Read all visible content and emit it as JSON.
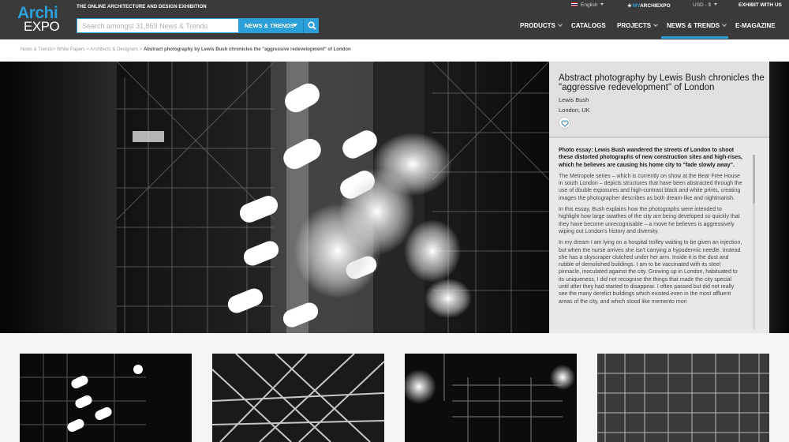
{
  "header": {
    "logo_top": "Archi",
    "logo_bottom": "EXPO",
    "tagline": "THE ONLINE ARCHITECTURE AND DESIGN EXHIBITION",
    "search_placeholder": "Search amongst 31,869 News & Trends",
    "search_category": "NEWS & TRENDS",
    "language": "English",
    "my_account_prefix": "MY",
    "my_account_suffix": "ARCHIEXPO",
    "currency": "USD - $",
    "exhibit": "EXHIBIT WITH US",
    "accent_color": "#2a9fd8",
    "nav": [
      {
        "label": "PRODUCTS",
        "has_menu": true
      },
      {
        "label": "CATALOGS",
        "has_menu": false
      },
      {
        "label": "PROJECTS",
        "has_menu": true
      },
      {
        "label": "NEWS & TRENDS",
        "has_menu": true,
        "active": true
      },
      {
        "label": "E-MAGAZINE",
        "has_menu": false
      }
    ]
  },
  "breadcrumb": {
    "items": [
      "News & Trends",
      "White Papers",
      "Architects & Designers"
    ],
    "current": "Abstract photography by Lewis Bush chronicles the \"aggressive redevelopment\" of London"
  },
  "article": {
    "title": "Abstract photography by Lewis Bush chronicles the \"aggressive redevelopment\" of London",
    "author": "Lewis Bush",
    "location": "London, UK",
    "paragraphs": [
      "Photo essay: Lewis Bush wandered the streets of London to shoot these distorted photographs of new construction sites and high-rises, which he believes are causing his home city to \"fade slowly away\".",
      "The Metropole series – which is currently on show at the Bear Free House in south London – depicts structures that have been abstracted through the use of double exposures and high-contrast black and white prints, creating images the photographer describes as both dream-like and nightmarish.",
      "In this essay, Bush explains how the photographs were intended to highlight how large swathes of the city are being developed so quickly that they have become unrecognisable – a move he believes is aggressively wiping out London's history and diversity.",
      "In my dream I am lying on a hospital trolley waiting to be given an injection, but when the nurse arrives she isn't carrying a hypodermic needle. Instead she has a skyscraper clutched under her arm. Inside it is the dust and rubble of demolished buildings. I am to be vaccinated with its steel pinnacle, inoculated against the city. Growing up in London, habituated to its uniqueness, I did not recognise the things that made the city special until after they had started to disappear. I often passed but did not really see the many derelict buildings which existed even in the most affluent areas of the city, and which stood like memento mori"
    ]
  },
  "thumbnails": [
    {
      "label": "thumbnail-1"
    },
    {
      "label": "thumbnail-2"
    },
    {
      "label": "thumbnail-3"
    },
    {
      "label": "thumbnail-4"
    }
  ]
}
